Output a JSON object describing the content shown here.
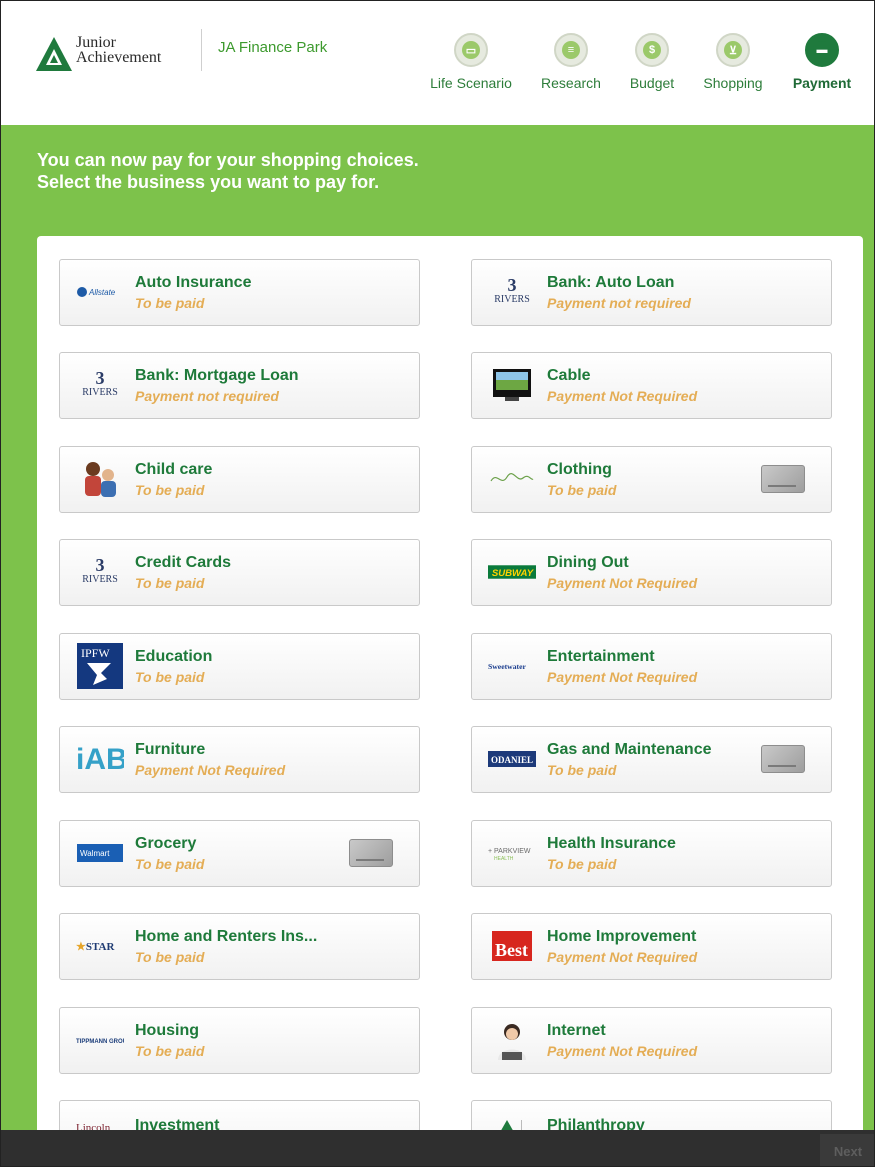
{
  "header": {
    "logo_line1": "Junior",
    "logo_line2": "Achievement",
    "app_name": "JA Finance Park",
    "steps": [
      {
        "label": "Life Scenario",
        "icon": "id-card-icon",
        "active": false
      },
      {
        "label": "Research",
        "icon": "research-icon",
        "active": false
      },
      {
        "label": "Budget",
        "icon": "coin-icon",
        "active": false
      },
      {
        "label": "Shopping",
        "icon": "cart-icon",
        "active": false
      },
      {
        "label": "Payment",
        "icon": "card-icon",
        "active": true
      }
    ]
  },
  "intro": "You can now pay for your shopping choices. Select the business you want to pay for.",
  "businesses": [
    {
      "name": "Auto Insurance",
      "status": "To be paid",
      "logo": "Allstate",
      "card_icon": false
    },
    {
      "name": "Bank: Auto Loan",
      "status": "Payment not required",
      "logo": "3 RIVERS",
      "card_icon": false
    },
    {
      "name": "Bank: Mortgage Loan",
      "status": "Payment not required",
      "logo": "3 RIVERS",
      "card_icon": false
    },
    {
      "name": "Cable",
      "status": "Payment Not Required",
      "logo": "tv",
      "card_icon": false
    },
    {
      "name": "Child care",
      "status": "To be paid",
      "logo": "child-photo",
      "card_icon": false
    },
    {
      "name": "Clothing",
      "status": "To be paid",
      "logo": "signature",
      "card_icon": true
    },
    {
      "name": "Credit Cards",
      "status": "To be paid",
      "logo": "3 RIVERS",
      "card_icon": false
    },
    {
      "name": "Dining Out",
      "status": "Payment Not Required",
      "logo": "SUBWAY",
      "card_icon": false
    },
    {
      "name": "Education",
      "status": "To be paid",
      "logo": "IPFW",
      "card_icon": false
    },
    {
      "name": "Entertainment",
      "status": "Payment Not Required",
      "logo": "Sweetwater",
      "card_icon": false
    },
    {
      "name": "Furniture",
      "status": "Payment Not Required",
      "logo": "IAB",
      "card_icon": false
    },
    {
      "name": "Gas and Maintenance",
      "status": "To be paid",
      "logo": "ODANIEL",
      "card_icon": true
    },
    {
      "name": "Grocery",
      "status": "To be paid",
      "logo": "Walmart",
      "card_icon": true
    },
    {
      "name": "Health Insurance",
      "status": "To be paid",
      "logo": "PARKVIEW",
      "card_icon": false
    },
    {
      "name": "Home and Renters Ins...",
      "status": "To be paid",
      "logo": "STAR",
      "card_icon": false
    },
    {
      "name": "Home Improvement",
      "status": "Payment Not Required",
      "logo": "Best",
      "card_icon": false
    },
    {
      "name": "Housing",
      "status": "To be paid",
      "logo": "TIPPMANN GROUP",
      "card_icon": false
    },
    {
      "name": "Internet",
      "status": "Payment Not Required",
      "logo": "person-photo",
      "card_icon": false
    },
    {
      "name": "Investment",
      "status": "",
      "logo": "Lincoln",
      "card_icon": false
    },
    {
      "name": "Philanthropy",
      "status": "",
      "logo": "JA",
      "card_icon": false
    }
  ],
  "footer": {
    "next_label": "Next"
  },
  "colors": {
    "brand_green": "#7dc24b",
    "title_green": "#1e7a3a",
    "status_orange": "#e4ad55",
    "footer": "#2f2f2f"
  }
}
